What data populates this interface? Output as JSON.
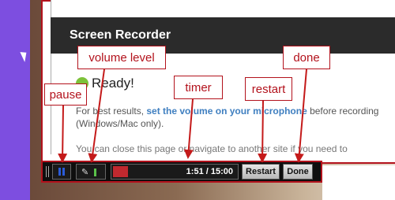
{
  "window": {
    "title": "Screen Recorder"
  },
  "status": {
    "text": "Ready!"
  },
  "description": {
    "before": "For best results, ",
    "link": "set the volume on your microphone",
    "after": " before recording (Windows/Mac only).",
    "partial": "You can close this page or navigate to another site if you need to"
  },
  "toolbar": {
    "timer": "1:51 / 15:00",
    "timer_progress_fraction": 0.123,
    "restart_label": "Restart",
    "done_label": "Done"
  },
  "annotations": {
    "pause": "pause",
    "volume": "volume level",
    "timer": "timer",
    "restart": "restart",
    "done": "done"
  },
  "colors": {
    "callout": "#b3121c",
    "link": "#3f7fc0",
    "progress": "#c0292f",
    "pause": "#2a5bd8"
  }
}
